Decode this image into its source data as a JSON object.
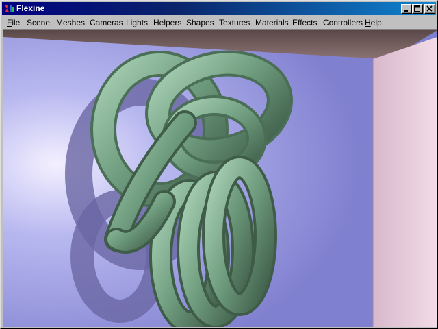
{
  "window": {
    "title": "Flexine",
    "controls": [
      "minimize",
      "maximize",
      "close"
    ]
  },
  "menu": {
    "items": [
      {
        "label": "File",
        "underline": "F",
        "rest": "ile"
      },
      {
        "label": "Scene",
        "underline": "",
        "rest": "Scene"
      },
      {
        "label": "Meshes",
        "underline": "",
        "rest": "Meshes"
      },
      {
        "label": "Cameras",
        "underline": "",
        "rest": "Cameras"
      },
      {
        "label": "Lights",
        "underline": "",
        "rest": "Lights"
      },
      {
        "label": "Helpers",
        "underline": "",
        "rest": "Helpers"
      },
      {
        "label": "Shapes",
        "underline": "",
        "rest": "Shapes"
      },
      {
        "label": "Textures",
        "underline": "",
        "rest": "Textures"
      },
      {
        "label": "Materials",
        "underline": "",
        "rest": "Materials"
      },
      {
        "label": "Effects",
        "underline": "",
        "rest": "Effects"
      },
      {
        "label": "Controllers",
        "underline": "",
        "rest": "Controllers"
      },
      {
        "label": "Help",
        "underline": "H",
        "rest": "elp"
      }
    ]
  },
  "colors": {
    "titlebar_start": "#000080",
    "titlebar_end": "#1084d0",
    "chrome": "#c0c0c0",
    "knot": "#7aa98a",
    "wall_left": "#b0b0ee",
    "wall_right": "#e8c8d8",
    "ceiling": "#6e5a5a"
  }
}
